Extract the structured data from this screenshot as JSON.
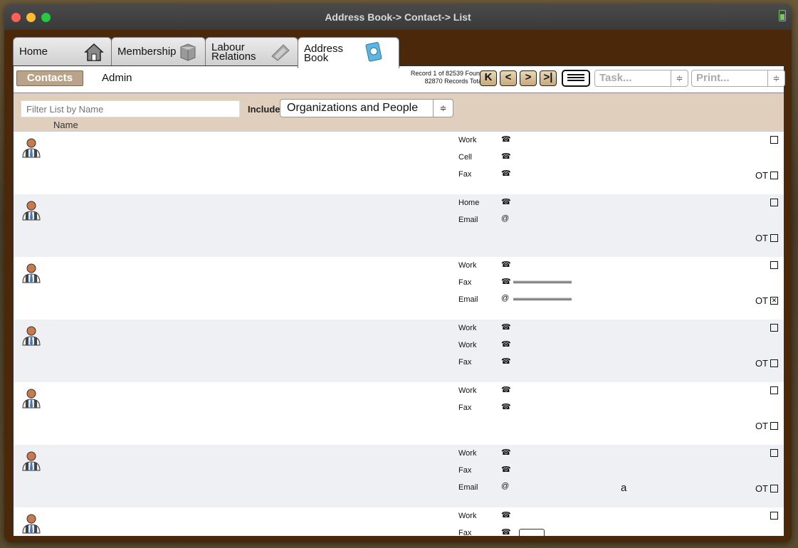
{
  "window": {
    "title": "Address Book-> Contact-> List"
  },
  "tabs": [
    {
      "label": "Home",
      "icon": "house-icon"
    },
    {
      "label": "Membership",
      "icon": "box-icon"
    },
    {
      "label1": "Labour",
      "label2": "Relations",
      "icon": "gavel-icon"
    },
    {
      "label1": "Address",
      "label2": "Book",
      "icon": "address-book-icon",
      "active": true
    }
  ],
  "subnav": {
    "contacts_label": "Contacts",
    "admin_label": "Admin",
    "record_found": "Record 1 of 82539 Found",
    "record_total": "82870 Records Total",
    "nav_first": "K",
    "nav_prev": "<",
    "nav_next": ">",
    "nav_last": ">|",
    "task_placeholder": "Task...",
    "print_placeholder": "Print..."
  },
  "filter": {
    "placeholder": "Filter List by Name",
    "include_label": "Include",
    "include_value": "Organizations and People",
    "name_header": "Name"
  },
  "rows": [
    {
      "phones": [
        {
          "label": "Work"
        },
        {
          "label": "Cell"
        },
        {
          "label": "Fax"
        }
      ],
      "ot": "OT",
      "ot_checked": false
    },
    {
      "phones": [
        {
          "label": "Home"
        },
        {
          "label": "Email",
          "email": true
        }
      ],
      "ot": "OT",
      "ot_checked": false
    },
    {
      "phones": [
        {
          "label": "Work"
        },
        {
          "label": "Fax"
        },
        {
          "label": "Email",
          "email": true
        }
      ],
      "ot": "OT",
      "ot_checked": true
    },
    {
      "phones": [
        {
          "label": "Work"
        },
        {
          "label": "Work"
        },
        {
          "label": "Fax"
        }
      ],
      "ot": "OT",
      "ot_checked": false
    },
    {
      "phones": [
        {
          "label": "Work"
        },
        {
          "label": "Fax"
        }
      ],
      "ot": "OT",
      "ot_checked": false
    },
    {
      "phones": [
        {
          "label": "Work"
        },
        {
          "label": "Fax"
        },
        {
          "label": "Email",
          "email": true,
          "extra": "a"
        }
      ],
      "ot": "OT",
      "ot_checked": false
    },
    {
      "phones": [
        {
          "label": "Work"
        },
        {
          "label": "Fax"
        }
      ],
      "ot": "",
      "ot_checked": false
    }
  ],
  "colors": {
    "accent": "#b9a48a",
    "window_bg": "#4a2809",
    "filter_bg": "#e0cfbd"
  }
}
